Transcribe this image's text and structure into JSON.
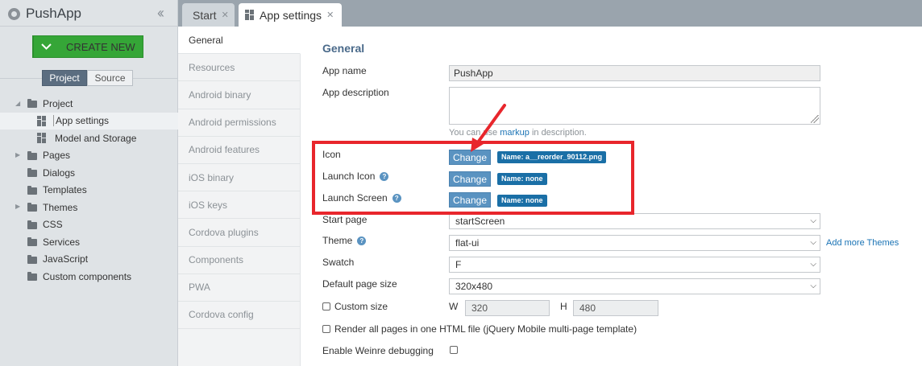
{
  "app": {
    "name": "PushApp"
  },
  "sidebar": {
    "create_label": "CREATE NEW",
    "segments": [
      "Project",
      "Source"
    ],
    "tree": [
      {
        "label": "Project",
        "type": "folder",
        "indent": 0,
        "expanded": true
      },
      {
        "label": "App settings",
        "type": "page",
        "indent": 1,
        "selected": true
      },
      {
        "label": "Model and Storage",
        "type": "page",
        "indent": 1
      },
      {
        "label": "Pages",
        "type": "folder",
        "indent": 0,
        "collapsed": true
      },
      {
        "label": "Dialogs",
        "type": "folder",
        "indent": 0
      },
      {
        "label": "Templates",
        "type": "folder",
        "indent": 0
      },
      {
        "label": "Themes",
        "type": "folder",
        "indent": 0,
        "collapsed": true
      },
      {
        "label": "CSS",
        "type": "folder",
        "indent": 0
      },
      {
        "label": "Services",
        "type": "folder",
        "indent": 0
      },
      {
        "label": "JavaScript",
        "type": "folder",
        "indent": 0
      },
      {
        "label": "Custom components",
        "type": "folder",
        "indent": 0
      }
    ]
  },
  "tabs": [
    {
      "label": "Start",
      "active": false
    },
    {
      "label": "App settings",
      "active": true
    }
  ],
  "settings_nav": [
    "General",
    "Resources",
    "Android binary",
    "Android permissions",
    "Android features",
    "iOS binary",
    "iOS keys",
    "Cordova plugins",
    "Components",
    "PWA",
    "Cordova config"
  ],
  "form": {
    "section_title": "General",
    "app_name_label": "App name",
    "app_name_value": "PushApp",
    "app_description_label": "App description",
    "hint_prefix": "You can use ",
    "hint_link": "markup",
    "hint_suffix": " in description.",
    "icon_label": "Icon",
    "launch_icon_label": "Launch Icon",
    "launch_screen_label": "Launch Screen",
    "change_label": "Change",
    "icon_badge": "Name: a__reorder_90112.png",
    "launch_icon_badge": "Name: none",
    "launch_screen_badge": "Name: none",
    "start_page_label": "Start page",
    "start_page_value": "startScreen",
    "theme_label": "Theme",
    "theme_value": "flat-ui",
    "add_themes_link": "Add more Themes",
    "swatch_label": "Swatch",
    "swatch_value": "F",
    "default_size_label": "Default page size",
    "default_size_value": "320x480",
    "custom_size_label": "Custom size",
    "w_label": "W",
    "w_value": "320",
    "h_label": "H",
    "h_value": "480",
    "render_all_label": "Render all pages in one HTML file (jQuery Mobile multi-page template)",
    "weinre_label": "Enable Weinre debugging"
  },
  "annotation": {
    "color": "#e8262c"
  }
}
